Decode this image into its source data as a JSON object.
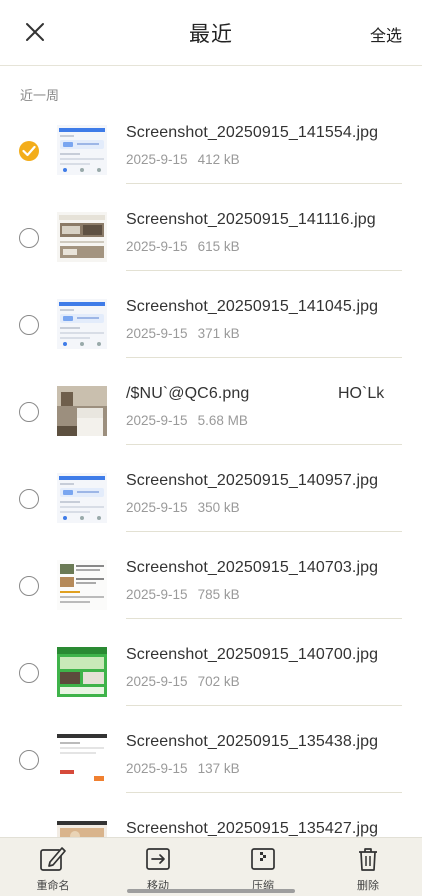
{
  "header": {
    "title": "最近",
    "select_all": "全选"
  },
  "section_label": "近一周",
  "files": [
    {
      "name": "Screenshot_20250915_141554.jpg",
      "date": "2025-9-15",
      "size": "412 kB",
      "checked": true,
      "thumb": "ui-blue"
    },
    {
      "name": "Screenshot_20250915_141116.jpg",
      "date": "2025-9-15",
      "size": "615 kB",
      "checked": false,
      "thumb": "kitchen-list"
    },
    {
      "name": "Screenshot_20250915_141045.jpg",
      "date": "2025-9-15",
      "size": "371 kB",
      "checked": false,
      "thumb": "ui-blue"
    },
    {
      "name": "/$NU`@QC6.png",
      "name_extra": "HO`Lk",
      "date": "2025-9-15",
      "size": "5.68 MB",
      "checked": false,
      "thumb": "room-photo"
    },
    {
      "name": "Screenshot_20250915_140957.jpg",
      "date": "2025-9-15",
      "size": "350 kB",
      "checked": false,
      "thumb": "ui-blue"
    },
    {
      "name": "Screenshot_20250915_140703.jpg",
      "date": "2025-9-15",
      "size": "785 kB",
      "checked": false,
      "thumb": "article"
    },
    {
      "name": "Screenshot_20250915_140700.jpg",
      "date": "2025-9-15",
      "size": "702 kB",
      "checked": false,
      "thumb": "green-site"
    },
    {
      "name": "Screenshot_20250915_135438.jpg",
      "date": "2025-9-15",
      "size": "137 kB",
      "checked": false,
      "thumb": "white-page"
    },
    {
      "name": "Screenshot_20250915_135427.jpg",
      "date": "",
      "size": "",
      "checked": false,
      "thumb": "food"
    }
  ],
  "toolbar": {
    "rename": "重命名",
    "move": "移动",
    "compress": "压缩",
    "delete": "删除"
  },
  "colors": {
    "accent": "#f3ad1b",
    "toolbar_bg": "#f2f0e9"
  }
}
